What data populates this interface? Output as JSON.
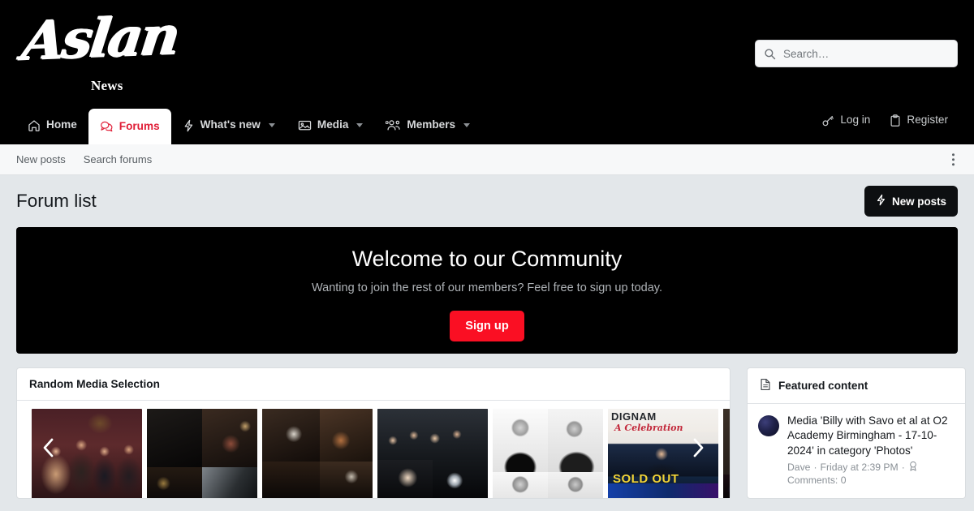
{
  "brand": {
    "logo_primary": "Aslan",
    "logo_secondary": "News"
  },
  "search": {
    "placeholder": "Search…",
    "value": "",
    "icon": "search-icon"
  },
  "nav": {
    "items": [
      {
        "label": "Home",
        "icon": "home-icon",
        "active": false,
        "caret": false
      },
      {
        "label": "Forums",
        "icon": "comments-icon",
        "active": true,
        "caret": false
      },
      {
        "label": "What's new",
        "icon": "bolt-icon",
        "active": false,
        "caret": true
      },
      {
        "label": "Media",
        "icon": "image-icon",
        "active": false,
        "caret": true
      },
      {
        "label": "Members",
        "icon": "users-icon",
        "active": false,
        "caret": true
      }
    ],
    "account": [
      {
        "label": "Log in",
        "icon": "key-icon"
      },
      {
        "label": "Register",
        "icon": "clipboard-icon"
      }
    ]
  },
  "subnav": {
    "items": [
      {
        "label": "New posts"
      },
      {
        "label": "Search forums"
      }
    ],
    "more_icon": "ellipsis-vertical-icon"
  },
  "page": {
    "title": "Forum list",
    "new_posts_button": "New posts",
    "new_posts_icon": "bolt-icon"
  },
  "welcome": {
    "heading": "Welcome to our Community",
    "subheading": "Wanting to join the rest of our members? Feel free to sign up today.",
    "cta": "Sign up",
    "cta_color": "#fa0f23"
  },
  "media_block": {
    "title": "Random Media Selection",
    "prev_icon": "chevron-left-icon",
    "next_icon": "chevron-right-icon",
    "thumbnails": [
      {
        "alt": "Group of four men posing indoors at a bar"
      },
      {
        "alt": "Dark venue interior collage"
      },
      {
        "alt": "Living room with people collage"
      },
      {
        "alt": "Band members on stage collage"
      },
      {
        "alt": "Black and white portraits of two men"
      },
      {
        "alt": "Dignam A Celebration concert poster - SOLD OUT"
      },
      {
        "alt": "Crowd at a lit concert venue"
      }
    ]
  },
  "featured": {
    "title": "Featured content",
    "icon": "document-icon",
    "item": {
      "title": "Media 'Billy with Savo et al at O2 Academy Birmingham - 17-10-2024' in category 'Photos'",
      "author": "Dave",
      "separator": "·",
      "date": "Friday at 2:39 PM",
      "badge_icon": "award-icon",
      "comments": "Comments: 0"
    }
  }
}
